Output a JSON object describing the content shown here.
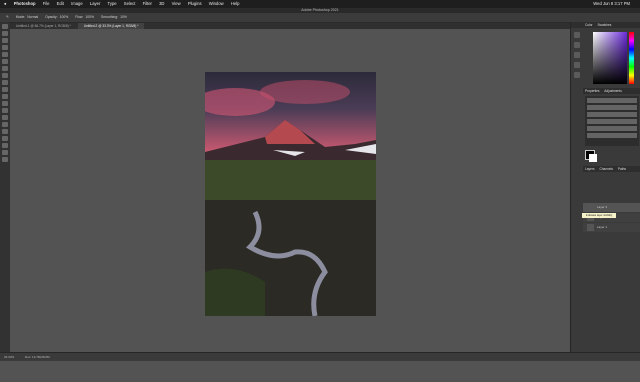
{
  "menubar": {
    "app": "Photoshop",
    "items": [
      "File",
      "Edit",
      "Image",
      "Layer",
      "Type",
      "Select",
      "Filter",
      "3D",
      "View",
      "Plugins",
      "Window",
      "Help"
    ],
    "clock": "Wed Jun 8  3:17 PM"
  },
  "window": {
    "title": "Adobe Photoshop 2021"
  },
  "options": {
    "mode_label": "Mode:",
    "mode_value": "Normal",
    "opacity_label": "Opacity:",
    "opacity_value": "100%",
    "flow_label": "Flow:",
    "flow_value": "100%",
    "smoothing_label": "Smoothing:",
    "smoothing_value": "10%"
  },
  "tabs": [
    {
      "label": "Untitled-1 @ 66.7% (Layer 1, RGB/8) *"
    },
    {
      "label": "Untitled-2 @ 33.3% (Layer 1, RGB/8) *"
    }
  ],
  "panels": {
    "top_tabs": [
      "Color",
      "Swatches"
    ],
    "adjust_tabs": [
      "Properties",
      "Adjustments"
    ],
    "layer_tabs": [
      "Layers",
      "Channels",
      "Paths"
    ]
  },
  "layers": [
    {
      "name": "Layer 3"
    },
    {
      "name": "Layer 2"
    },
    {
      "name": "Layer 1"
    }
  ],
  "tooltip": "Indicates layer visibility",
  "status": {
    "zoom": "33.33%",
    "doc": "Doc: 13.7M/28.6M"
  },
  "colors": {
    "picked": "#6a2bdc"
  }
}
